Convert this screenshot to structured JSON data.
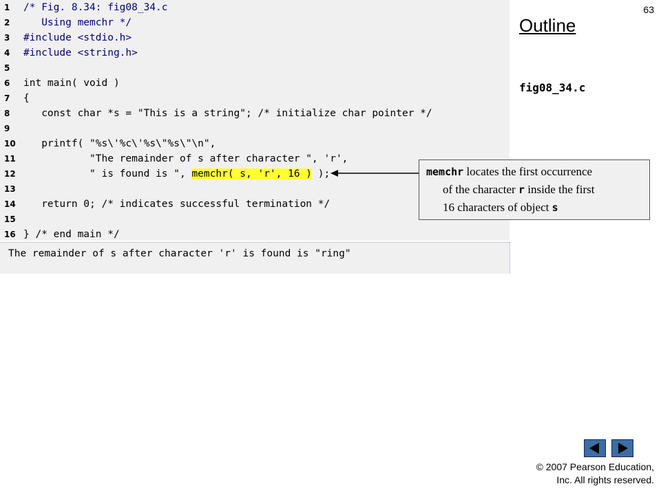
{
  "slide": {
    "number": "63",
    "outline_title": "Outline",
    "file_name": "fig08_34.c",
    "footer_line1": "© 2007 Pearson Education,",
    "footer_line2": "Inc.  All rights reserved."
  },
  "code_lines": [
    {
      "n": "1",
      "text": "/* Fig. 8.34: fig08_34.c"
    },
    {
      "n": "2",
      "text": "   Using memchr */"
    },
    {
      "n": "3",
      "text": "#include <stdio.h>"
    },
    {
      "n": "4",
      "text": "#include <string.h>"
    },
    {
      "n": "5",
      "text": ""
    },
    {
      "n": "6",
      "text": "int main( void )"
    },
    {
      "n": "7",
      "text": "{"
    },
    {
      "n": "8",
      "text": "   const char *s = \"This is a string\"; /* initialize char pointer */"
    },
    {
      "n": "9",
      "text": ""
    },
    {
      "n": "10",
      "text": "   printf( \"%s\\'%c\\'%s\\\"%s\\\"\\n\","
    },
    {
      "n": "11",
      "text": "           \"The remainder of s after character \", 'r',"
    },
    {
      "n": "12",
      "pre": "           \" is found is \", ",
      "hl": "memchr( s, 'r', 16 )",
      "post": " );"
    },
    {
      "n": "13",
      "text": ""
    },
    {
      "n": "14",
      "text": "   return 0; /* indicates successful termination */"
    },
    {
      "n": "15",
      "text": ""
    },
    {
      "n": "16",
      "text": "} /* end main */"
    }
  ],
  "output": "The remainder of s after character 'r' is found is \"ring\"",
  "callout": {
    "code1": "memchr",
    "text1": " locates the first occurrence",
    "text2": "of the character ",
    "code2": "r",
    "text3": " inside the first",
    "text4": "16 characters of object ",
    "code3": "s"
  },
  "nav": {
    "prev_icon": "triangle-left-icon",
    "next_icon": "triangle-right-icon"
  }
}
